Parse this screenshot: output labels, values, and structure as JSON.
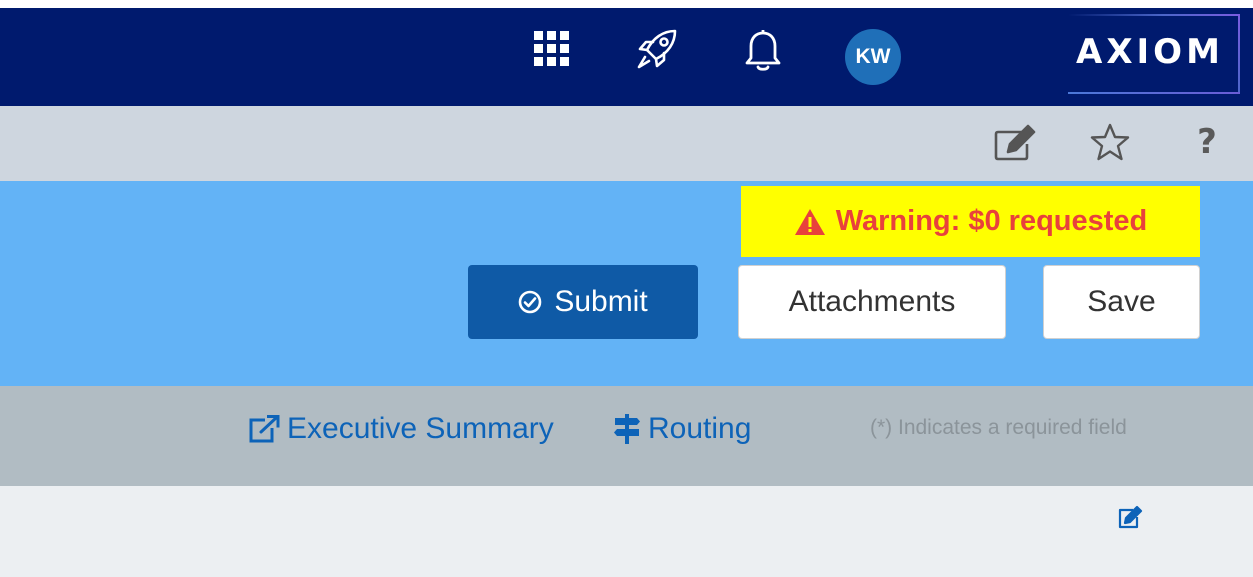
{
  "header": {
    "avatar_initials": "KW",
    "logo_text": "AXIOM",
    "icons": [
      "apps-grid-icon",
      "rocket-icon",
      "bell-icon"
    ]
  },
  "toolbar": {
    "icons": [
      "edit-document-icon",
      "star-icon",
      "help-icon"
    ],
    "help_label": "?"
  },
  "actions": {
    "warning_text": "Warning: $0 requested",
    "submit_label": "Submit",
    "attachments_label": "Attachments",
    "save_label": "Save"
  },
  "links": {
    "executive_summary_label": "Executive Summary",
    "routing_label": "Routing",
    "required_note": "(*) Indicates a required field"
  },
  "colors": {
    "navbar": "#001a6e",
    "subbar": "#ced6df",
    "action_band": "#63b3f6",
    "warning_bg": "#ffff00",
    "warning_text": "#e8413c",
    "submit_bg": "#0f5aa6",
    "link": "#0d63b8",
    "linkbar": "#b1bcc3",
    "bottom": "#eceff2"
  }
}
